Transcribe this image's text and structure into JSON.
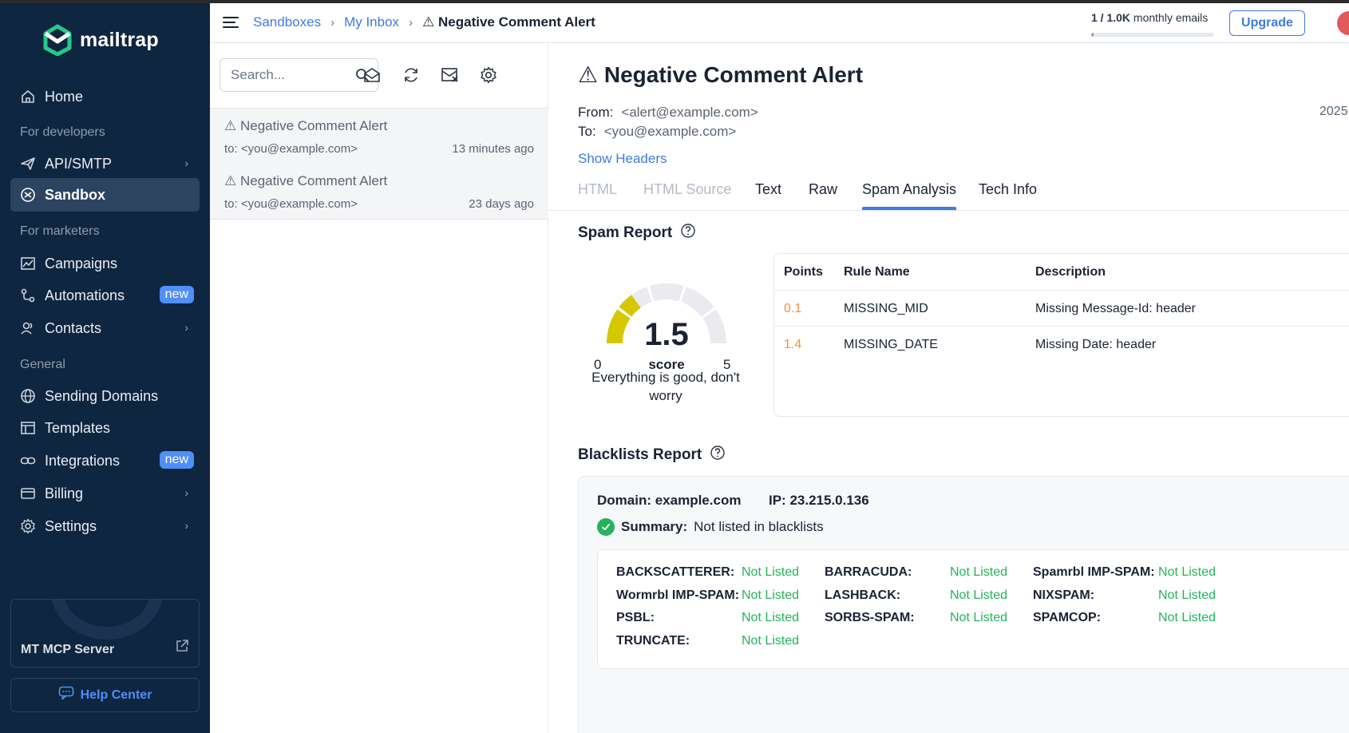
{
  "sidebar": {
    "logo_text": "mailtrap",
    "items": {
      "home": "Home",
      "section_developers": "For developers",
      "api_smtp": "API/SMTP",
      "sandbox": "Sandbox",
      "section_marketers": "For marketers",
      "campaigns": "Campaigns",
      "automations": "Automations",
      "contacts": "Contacts",
      "section_general": "General",
      "sending_domains": "Sending Domains",
      "templates": "Templates",
      "integrations": "Integrations",
      "billing": "Billing",
      "settings": "Settings"
    },
    "new_badge": "new",
    "mcp_server": "MT MCP Server",
    "help_center": "Help Center"
  },
  "header": {
    "breadcrumb": [
      "Sandboxes",
      "My Inbox",
      "⚠ Negative Comment Alert"
    ],
    "quota_used": "1 / 1.0K",
    "quota_text": "monthly emails",
    "quota_progress": 0.001,
    "upgrade": "Upgrade"
  },
  "list": {
    "search_placeholder": "Search...",
    "messages": [
      {
        "subject": "⚠ Negative Comment Alert",
        "to": "to: <you@example.com>",
        "time": "13 minutes ago"
      },
      {
        "subject": "⚠ Negative Comment Alert",
        "to": "to: <you@example.com>",
        "time": "23 days ago"
      }
    ]
  },
  "detail": {
    "title": "⚠ Negative Comment Alert",
    "from_label": "From:",
    "from_value": "<alert@example.com>",
    "to_label": "To:",
    "to_value": "<you@example.com>",
    "date_partial": "2025",
    "show_headers": "Show Headers",
    "tabs": [
      "HTML",
      "HTML Source",
      "Text",
      "Raw",
      "Spam Analysis",
      "Tech Info"
    ],
    "active_tab": "Spam Analysis"
  },
  "spam": {
    "title": "Spam Report",
    "score": "1.5",
    "score_value": 1.5,
    "score_max": 5,
    "score_label": "score",
    "min": "0",
    "max": "5",
    "message": "Everything is good, don't worry",
    "columns": [
      "Points",
      "Rule Name",
      "Description"
    ],
    "rows": [
      {
        "points": "0.1",
        "rule": "MISSING_MID",
        "description": "Missing Message-Id: header"
      },
      {
        "points": "1.4",
        "rule": "MISSING_DATE",
        "description": "Missing Date: header"
      }
    ]
  },
  "blacklists": {
    "title": "Blacklists Report",
    "domain": "Domain: example.com",
    "ip": "IP: 23.215.0.136",
    "summary_label": "Summary:",
    "summary_value": "Not listed in blacklists",
    "entries": [
      {
        "name": "BACKSCATTERER:",
        "status": "Not Listed"
      },
      {
        "name": "BARRACUDA:",
        "status": "Not Listed"
      },
      {
        "name": "Spamrbl IMP-SPAM:",
        "status": "Not Listed"
      },
      {
        "name": "Wormrbl IMP-SPAM:",
        "status": "Not Listed"
      },
      {
        "name": "LASHBACK:",
        "status": "Not Listed"
      },
      {
        "name": "NIXSPAM:",
        "status": "Not Listed"
      },
      {
        "name": "PSBL:",
        "status": "Not Listed"
      },
      {
        "name": "SORBS-SPAM:",
        "status": "Not Listed"
      },
      {
        "name": "SPAMCOP:",
        "status": "Not Listed"
      },
      {
        "name": "TRUNCATE:",
        "status": "Not Listed"
      }
    ]
  },
  "colors": {
    "sidebar_bg": "#0f2640",
    "accent": "#3d7be0",
    "ok_green": "#23b35a",
    "points_orange": "#f29339",
    "gauge_fill": "#d6c800"
  }
}
